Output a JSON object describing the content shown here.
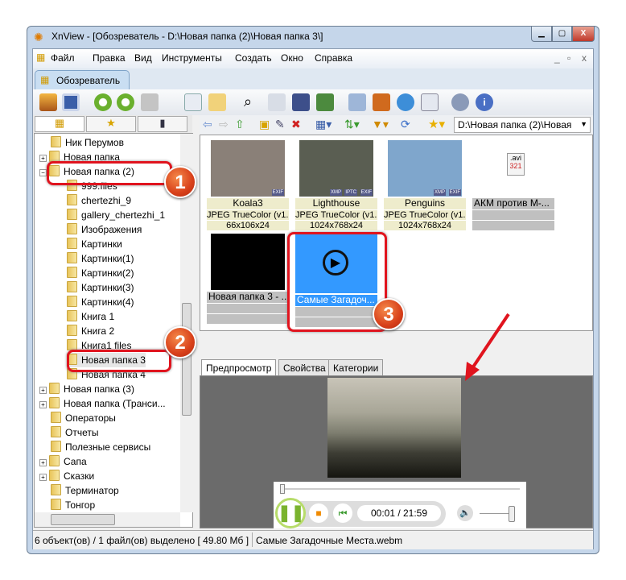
{
  "window": {
    "title": "XnView - [Обозреватель - D:\\Новая папка (2)\\Новая папка 3\\]",
    "minimize": "▁",
    "maximize": "▢",
    "close": "X"
  },
  "menu": [
    "Файл",
    "Правка",
    "Вид",
    "Инструменты",
    "Создать",
    "Окно",
    "Справка"
  ],
  "tab": {
    "label": "Обозреватель"
  },
  "sidetabs": [
    "folders",
    "favorites",
    "categories"
  ],
  "tree": [
    {
      "label": "Ник Перумов",
      "level": 1
    },
    {
      "label": "Новая папка",
      "level": 1,
      "expander": "+"
    },
    {
      "label": "Новая папка (2)",
      "level": 1,
      "expander": "−"
    },
    {
      "label": "999.files",
      "level": 2
    },
    {
      "label": "chertezhi_9",
      "level": 2
    },
    {
      "label": "gallery_chertezhi_1",
      "level": 2
    },
    {
      "label": "Изображения",
      "level": 2
    },
    {
      "label": "Картинки",
      "level": 2
    },
    {
      "label": "Картинки(1)",
      "level": 2
    },
    {
      "label": "Картинки(2)",
      "level": 2
    },
    {
      "label": "Картинки(3)",
      "level": 2
    },
    {
      "label": "Картинки(4)",
      "level": 2
    },
    {
      "label": "Книга 1",
      "level": 2
    },
    {
      "label": "Книга 2",
      "level": 2
    },
    {
      "label": "Книга1 files",
      "level": 2
    },
    {
      "label": "Новая папка 3",
      "level": 2,
      "selected": true
    },
    {
      "label": "Новая папка 4",
      "level": 2
    },
    {
      "label": "Новая папка (3)",
      "level": 1,
      "expander": "+"
    },
    {
      "label": "Новая папка (Транси...",
      "level": 1,
      "expander": "+"
    },
    {
      "label": "Операторы",
      "level": 1
    },
    {
      "label": "Отчеты",
      "level": 1
    },
    {
      "label": "Полезные сервисы",
      "level": 1
    },
    {
      "label": "Сапа",
      "level": 1,
      "expander": "+"
    },
    {
      "label": "Сказки",
      "level": 1,
      "expander": "+"
    },
    {
      "label": "Терминатор",
      "level": 1
    },
    {
      "label": "Тонгор",
      "level": 1
    }
  ],
  "path": "D:\\Новая папка (2)\\Новая",
  "thumbnails": [
    {
      "name": "Koala3",
      "type": "JPEG TrueColor (v1.1)",
      "size": "66x106x24",
      "badges": [
        "EXIF"
      ],
      "color": "#8a8078"
    },
    {
      "name": "Lighthouse",
      "type": "JPEG TrueColor (v1.1)",
      "size": "1024x768x24",
      "badges": [
        "XMP",
        "IPTC",
        "EXIF"
      ],
      "color": "#5a5e52"
    },
    {
      "name": "Penguins",
      "type": "JPEG TrueColor (v1.1)",
      "size": "1024x768x24",
      "badges": [
        "XMP",
        "EXIF"
      ],
      "color": "#7fa6cc"
    },
    {
      "name": "АКМ против М-...",
      "type": "",
      "size": "",
      "badges": [],
      "icon": ".avi"
    },
    {
      "name": "Новая папка 3 - ...",
      "type": "",
      "size": "",
      "badges": [],
      "color": "#000"
    },
    {
      "name": "Самые Загадоч...",
      "type": "",
      "size": "",
      "badges": [],
      "selected": true
    }
  ],
  "preview_tabs": [
    "Предпросмотр",
    "Свойства",
    "Категории"
  ],
  "player": {
    "time": "00:01 / 21:59",
    "progress": 0.001,
    "volume": 1.0
  },
  "status": {
    "count": "6 объект(ов) / 1 файл(ов) выделено  [ 49.80 Мб ]",
    "file": "Самые Загадочные Места.webm"
  },
  "annotations": [
    "1",
    "2",
    "3"
  ],
  "colors": {
    "selection": "#3399ff",
    "annotation": "#e0141e"
  }
}
